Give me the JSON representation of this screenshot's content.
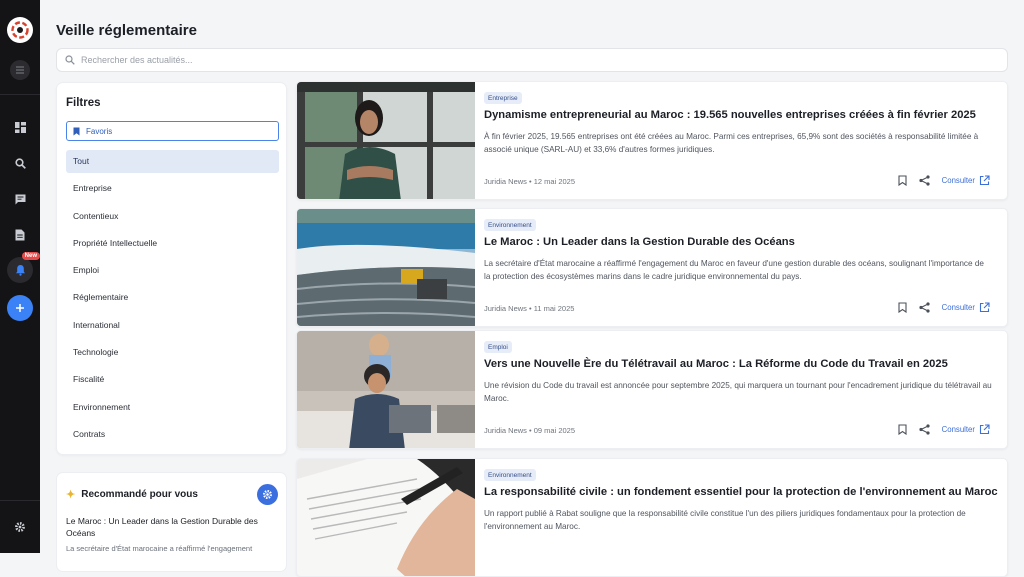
{
  "page": {
    "title": "Veille réglementaire"
  },
  "search": {
    "placeholder": "Rechercher des actualités..."
  },
  "rail": {
    "new_badge": "New"
  },
  "filters": {
    "title": "Filtres",
    "favorites_label": "Favoris",
    "items": [
      "Tout",
      "Entreprise",
      "Contentieux",
      "Propriété Intellectuelle",
      "Emploi",
      "Réglementaire",
      "International",
      "Technologie",
      "Fiscalité",
      "Environnement",
      "Contrats"
    ],
    "active": "Tout"
  },
  "recommended": {
    "title": "Recommandé pour vous",
    "item_title": "Le Maroc : Un Leader dans la Gestion Durable des Océans",
    "item_excerpt": "La secrétaire d'État marocaine a réaffirmé l'engagement"
  },
  "articles": [
    {
      "tag": "Entreprise",
      "title": "Dynamisme entrepreneurial au Maroc : 19.565 nouvelles entreprises créées à fin février 2025",
      "description": "À fin février 2025, 19.565 entreprises ont été créées au Maroc. Parmi ces entreprises, 65,9% sont des sociétés à responsabilité limitée à associé unique (SARL-AU) et 33,6% d'autres formes juridiques.",
      "meta": "Juridia News  •  12 mai 2025",
      "action": "Consulter"
    },
    {
      "tag": "Environnement",
      "title": "Le Maroc : Un Leader dans la Gestion Durable des Océans",
      "description": "La secrétaire d'État marocaine a réaffirmé l'engagement du Maroc en faveur d'une gestion durable des océans, soulignant l'importance de la protection des écosystèmes marins dans le cadre juridique environnemental du pays.",
      "meta": "Juridia News  •  11 mai 2025",
      "action": "Consulter"
    },
    {
      "tag": "Emploi",
      "title": "Vers une Nouvelle Ère du Télétravail au Maroc : La Réforme du Code du Travail en 2025",
      "description": "Une révision du Code du travail est annoncée pour septembre 2025, qui marquera un tournant pour l'encadrement juridique du télétravail au Maroc.",
      "meta": "Juridia News  •  09 mai 2025",
      "action": "Consulter"
    },
    {
      "tag": "Environnement",
      "title": "La responsabilité civile : un fondement essentiel pour la protection de l'environnement au Maroc",
      "description": "Un rapport publié à Rabat souligne que la responsabilité civile constitue l'un des piliers juridiques fondamentaux pour la protection de l'environnement au Maroc.",
      "meta": "",
      "action": ""
    }
  ],
  "colors": {
    "accent": "#3b82f6",
    "rail": "#141416",
    "tag_bg": "#e6ecf8",
    "link": "#3c6fd8"
  }
}
